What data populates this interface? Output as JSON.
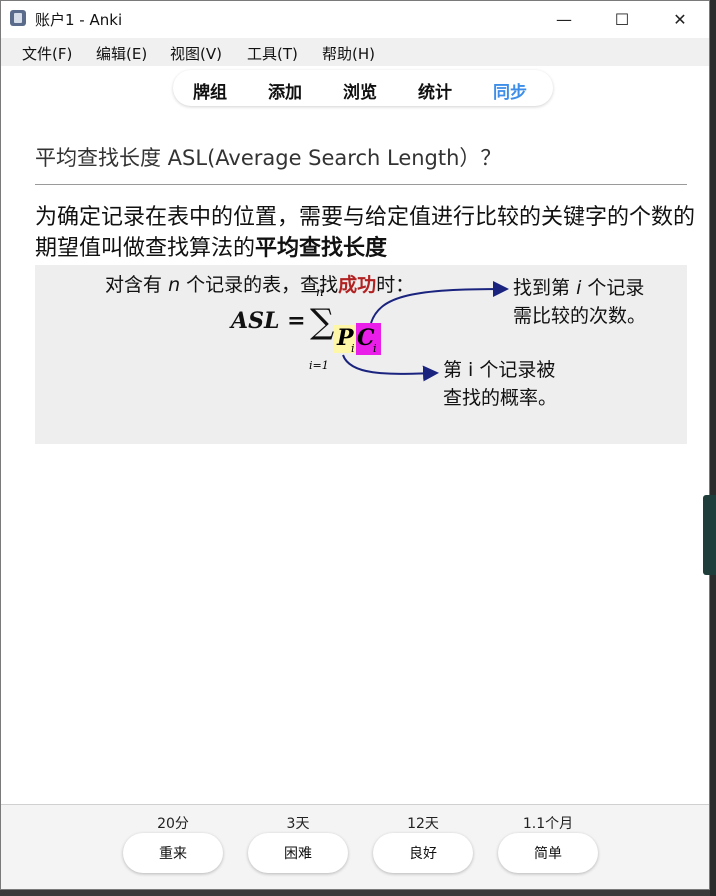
{
  "window": {
    "title": "账户1 - Anki",
    "minimize": "—",
    "maximize": "☐",
    "close": "✕"
  },
  "menu": [
    "文件(F)",
    "编辑(E)",
    "视图(V)",
    "工具(T)",
    "帮助(H)"
  ],
  "toolbar": {
    "items": [
      "牌组",
      "添加",
      "浏览",
      "统计",
      "同步"
    ],
    "active_index": 4
  },
  "card": {
    "question": "平均查找长度 ASL(Average Search Length）？",
    "answer_plain": "为确定记录在表中的位置，需要与给定值进行比较的关键字的个数的期望值叫做查找算法的",
    "answer_bold": "平均查找长度"
  },
  "figure": {
    "intro_prefix": "对含有",
    "intro_var": "n",
    "intro_middle": "个记录的表，查找",
    "intro_red": "成功",
    "intro_suffix": "时：",
    "formula_lhs": "ASL =",
    "sum_top": "n",
    "sum_bottom": "i=1",
    "term_p": "P",
    "term_c": "C",
    "sub": "i",
    "note1_line1_prefix": "找到第",
    "note1_var": "i",
    "note1_line1_suffix": "个记录",
    "note1_line2": "需比较的次数。",
    "note2_line1": "第 i 个记录被",
    "note2_line2": "查找的概率。"
  },
  "ease": [
    {
      "time": "20分",
      "label": "重来"
    },
    {
      "time": "3天",
      "label": "困难"
    },
    {
      "time": "12天",
      "label": "良好"
    },
    {
      "time": "1.1个月",
      "label": "简单"
    }
  ],
  "colors": {
    "active": "#3d8ee8",
    "highlight_p": "#fff7a8",
    "highlight_c": "#e91ee9",
    "arrow": "#1a237e",
    "red": "#b22222"
  }
}
